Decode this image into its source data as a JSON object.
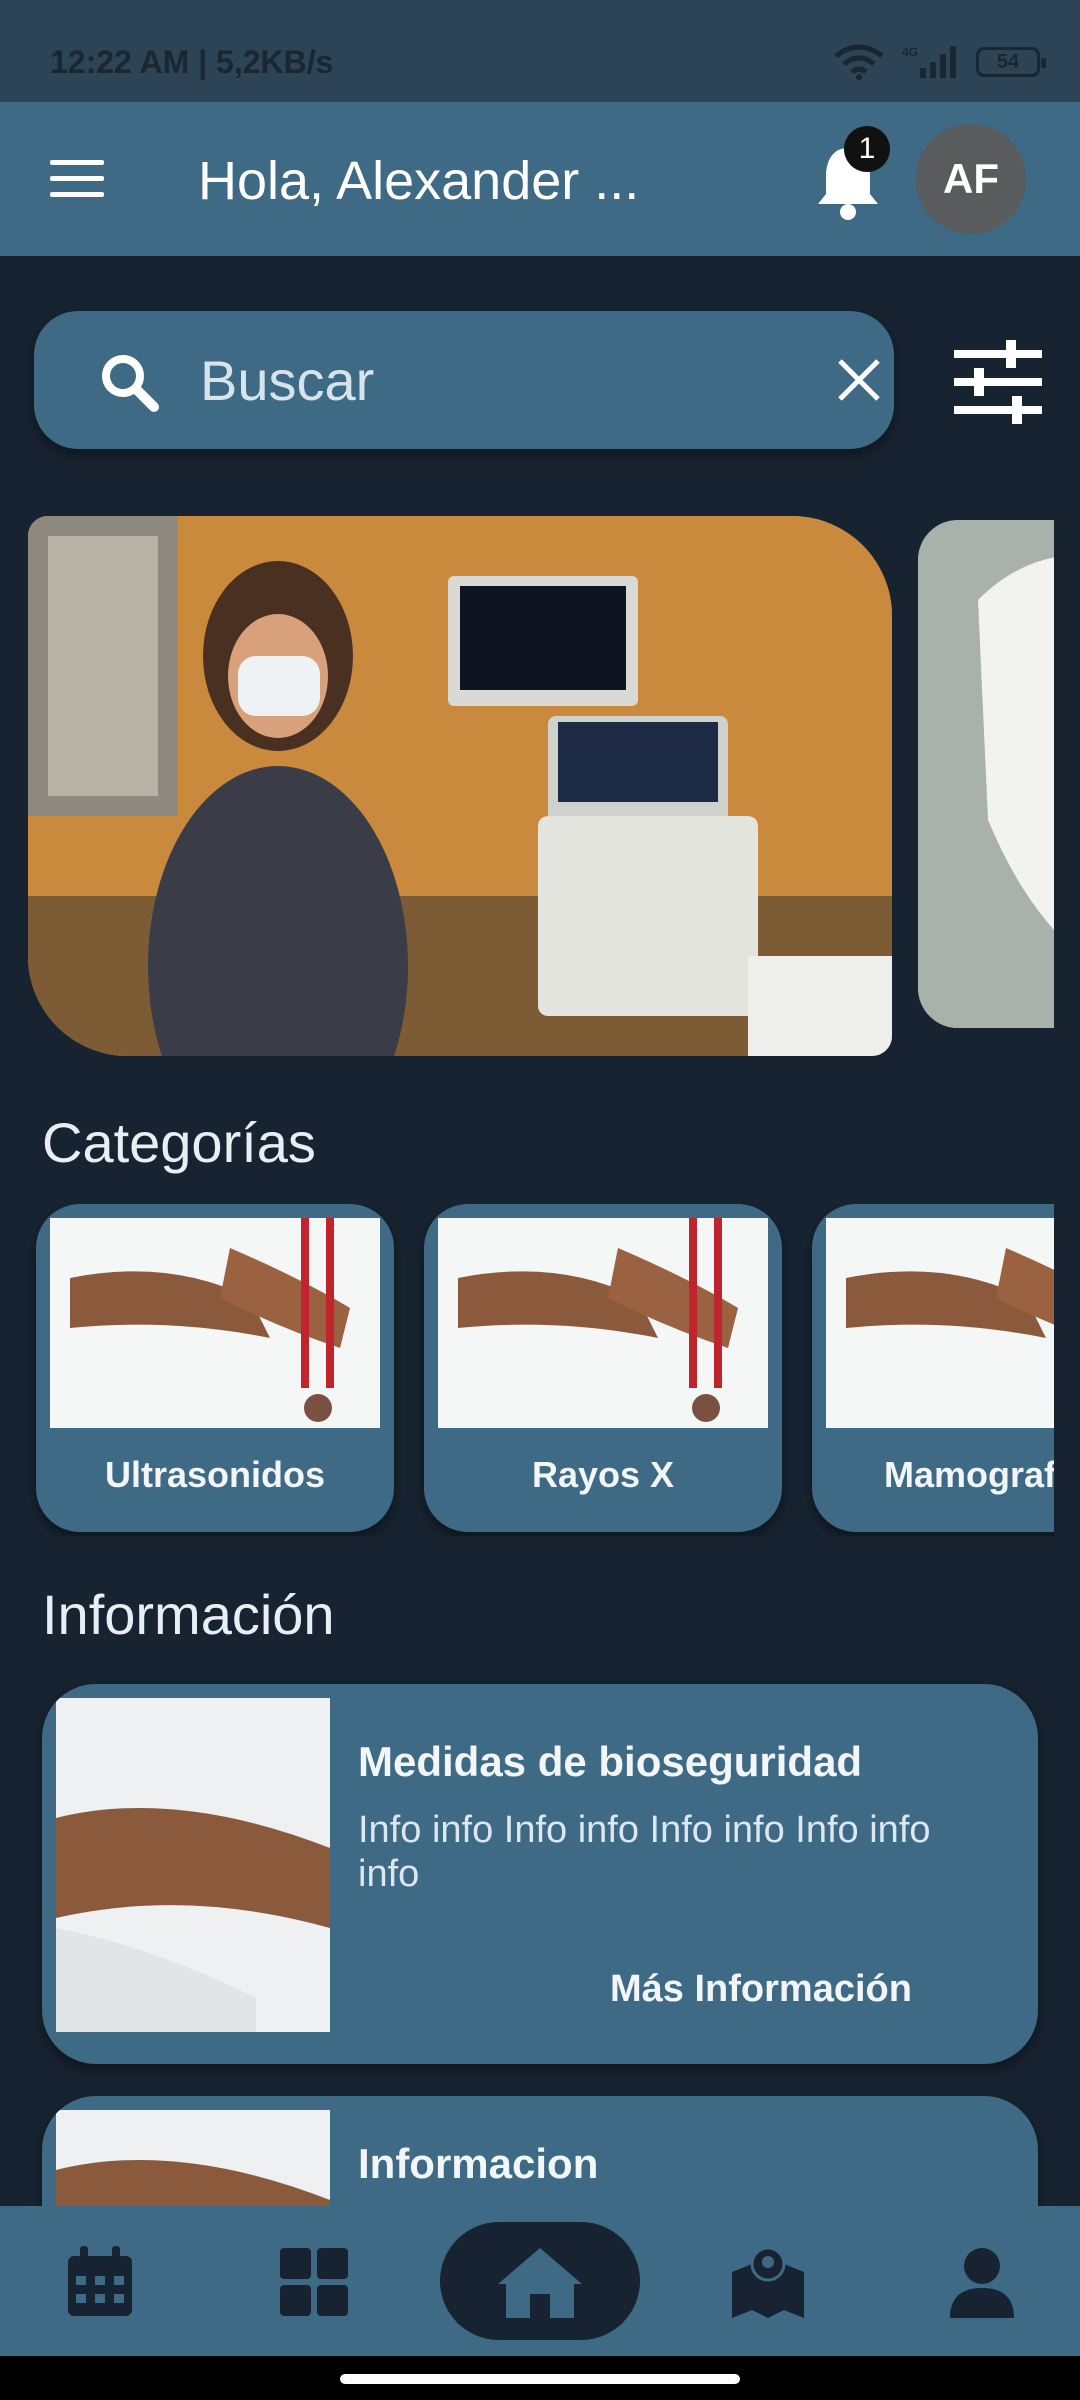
{
  "status_bar": {
    "time": "12:22 AM | 5,2KB/s",
    "network": "4G",
    "battery": "54"
  },
  "app_bar": {
    "greeting": "Hola, Alexander ...",
    "notification_count": "1",
    "avatar_initials": "AF"
  },
  "search": {
    "placeholder": "Buscar"
  },
  "sections": {
    "categories_title": "Categorías",
    "info_title": "Información"
  },
  "categories": [
    {
      "label": "Ultrasonidos"
    },
    {
      "label": "Rayos X"
    },
    {
      "label": "Mamografía"
    }
  ],
  "info_cards": [
    {
      "title": "Medidas de bioseguridad",
      "body": "Info info  Info info Info info Info info info",
      "more": "Más Información"
    },
    {
      "title": "Informacion",
      "body": "",
      "more": ""
    }
  ],
  "bottom_nav": [
    "calendar-icon",
    "grid-icon",
    "home-icon",
    "map-icon",
    "person-icon"
  ],
  "colors": {
    "background": "#172330",
    "primary": "#3e6a85",
    "status_bar": "#2c4455"
  }
}
